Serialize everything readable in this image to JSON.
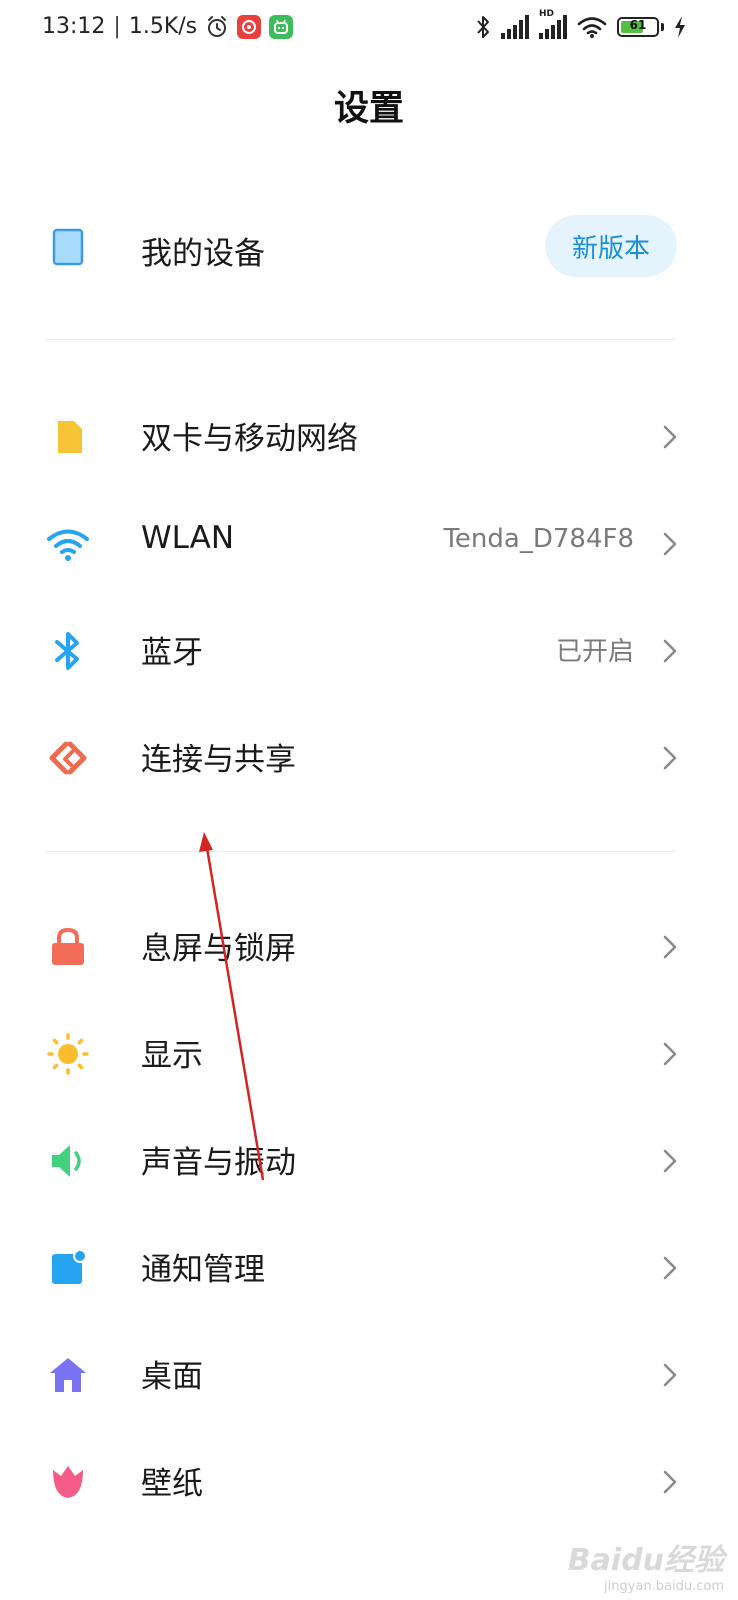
{
  "status_bar": {
    "time": "13:12",
    "net_speed": "1.5K/s",
    "battery": "61",
    "hd_label": "HD"
  },
  "page": {
    "title": "设置"
  },
  "device": {
    "label": "我的设备",
    "badge": "新版本",
    "icon": "tablet-icon"
  },
  "group1": [
    {
      "label": "双卡与移动网络",
      "value": "",
      "icon": "sim-card-icon"
    },
    {
      "label": "WLAN",
      "value": "Tenda_D784F8",
      "icon": "wifi-icon"
    },
    {
      "label": "蓝牙",
      "value": "已开启",
      "icon": "bluetooth-icon"
    },
    {
      "label": "连接与共享",
      "value": "",
      "icon": "connection-share-icon"
    }
  ],
  "group2": [
    {
      "label": "息屏与锁屏",
      "value": "",
      "icon": "lock-icon"
    },
    {
      "label": "显示",
      "value": "",
      "icon": "sun-icon"
    },
    {
      "label": "声音与振动",
      "value": "",
      "icon": "speaker-icon"
    },
    {
      "label": "通知管理",
      "value": "",
      "icon": "notification-icon"
    },
    {
      "label": "桌面",
      "value": "",
      "icon": "home-icon"
    },
    {
      "label": "壁纸",
      "value": "",
      "icon": "tulip-icon"
    }
  ],
  "watermark": {
    "main": "Baidu经验",
    "sub": "jingyan.baidu.com"
  },
  "colors": {
    "accent_blue": "#1a8fd8",
    "badge_bg": "#e5f4fc",
    "annotation_arrow": "#d42424"
  }
}
